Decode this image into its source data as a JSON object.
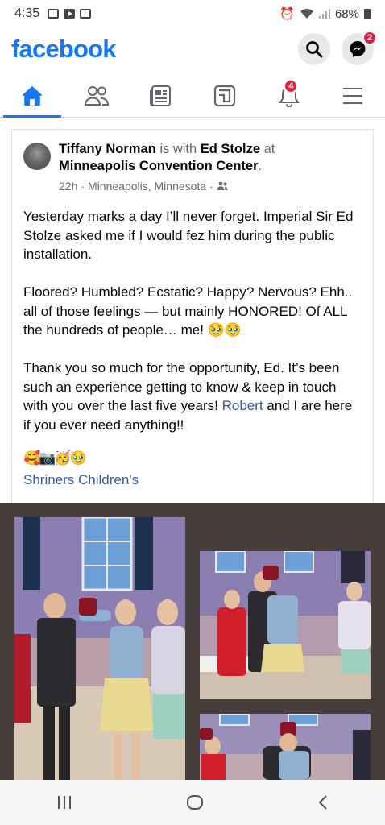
{
  "status_bar": {
    "time": "4:35",
    "battery": "68%"
  },
  "header": {
    "logo": "facebook",
    "messenger_badge": "2"
  },
  "tabs": [
    {
      "name": "home",
      "active": true
    },
    {
      "name": "friends"
    },
    {
      "name": "news"
    },
    {
      "name": "groups"
    },
    {
      "name": "notifications",
      "badge": "4"
    },
    {
      "name": "menu"
    }
  ],
  "post": {
    "author": "Tiffany Norman",
    "is_with": "is with",
    "tagged": "Ed Stolze",
    "at": "at",
    "location": "Minneapolis Convention Center",
    "period": ".",
    "time": "22h",
    "place": "Minneapolis, Minnesota",
    "sep": "·",
    "paragraph1": "Yesterday marks a day I’ll never forget. Imperial Sir Ed Stolze asked me if I would fez him during the public installation.",
    "paragraph2": "Floored? Humbled? Ecstatic? Happy? Nervous? Ehh.. all of those feelings — but mainly HONORED! Of ALL the hundreds of people… me! 🥹🥹",
    "paragraph3_before": "Thank you so much for the opportunity, Ed. It’s been such an experience getting to know & keep in touch with you over the last five years! ",
    "paragraph3_link": "Robert",
    "paragraph3_after": " and I are here if you ever need anything!!",
    "emojis": "🥰📷🥳🥹",
    "hashtag": "Shriners Children's"
  },
  "colors": {
    "brand": "#1877f2",
    "badge": "#e41e3f",
    "link": "#385898",
    "photo_bg": "#473d3b"
  }
}
